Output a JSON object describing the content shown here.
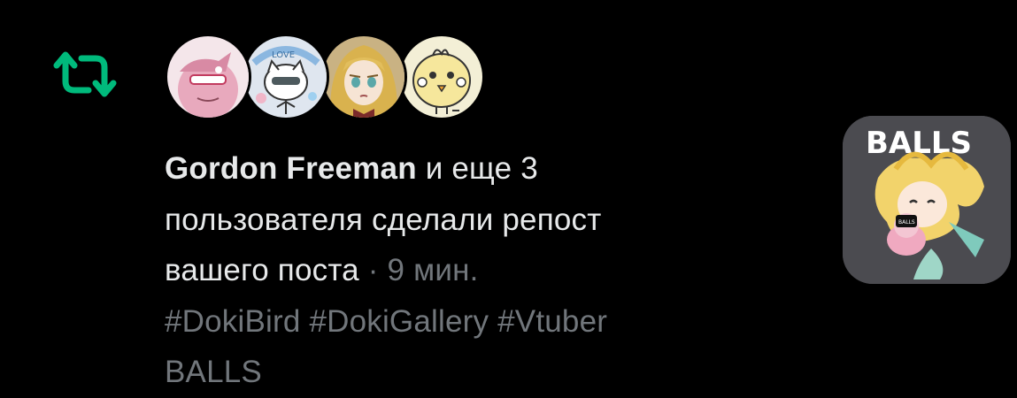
{
  "notification": {
    "actor_name": "Gordon Freeman",
    "line1_rest": " и еще 3",
    "line2": "пользователя сделали репост",
    "line3": "вашего поста",
    "separator": " · ",
    "time": "9 мин.",
    "hashtags": "#DokiBird #DokiGallery #Vtuber",
    "post_text": "BALLS"
  },
  "avatars": [
    {
      "icon": "avatar-pink-character"
    },
    {
      "icon": "avatar-cat-love"
    },
    {
      "icon": "avatar-blonde-girl"
    },
    {
      "icon": "avatar-chick-drawing"
    }
  ],
  "thumbnail": {
    "label": "BALLS",
    "badge_text": "BALLS"
  },
  "colors": {
    "repost_green": "#00ba7c",
    "text": "#e7e9ea",
    "muted": "#71767b",
    "background": "#000000"
  }
}
